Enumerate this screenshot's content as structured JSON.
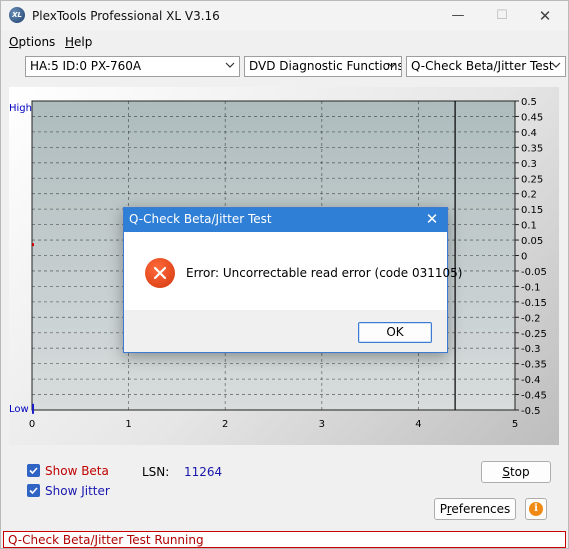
{
  "window": {
    "title": "PlexTools Professional XL V3.16",
    "icon_label": "XL"
  },
  "menu": {
    "options": "Options",
    "help": "Help"
  },
  "toolbar": {
    "drive": "HA:5 ID:0  PX-760A",
    "function": "DVD Diagnostic Functions",
    "test": "Q-Check Beta/Jitter Test"
  },
  "chart_data": {
    "type": "line",
    "x_ticks": [
      "0",
      "1",
      "2",
      "3",
      "4",
      "5"
    ],
    "xlim": [
      0,
      5
    ],
    "left_labels": {
      "top": "High",
      "bottom": "Low"
    },
    "y_right_ticks": [
      "0.5",
      "0.45",
      "0.4",
      "0.35",
      "0.3",
      "0.25",
      "0.2",
      "0.15",
      "0.1",
      "0.05",
      "0",
      "-0.05",
      "-0.1",
      "-0.15",
      "-0.2",
      "-0.25",
      "-0.3",
      "-0.35",
      "-0.4",
      "-0.45",
      "-0.5"
    ],
    "ylim": [
      -0.5,
      0.5
    ],
    "grid": true,
    "marker_x": 4.38,
    "colors": {
      "plot_bg": "#b7c4c6",
      "grid": "#1a1a1a",
      "marker": "#000000",
      "left_text": "#0000c0"
    }
  },
  "dialog": {
    "title": "Q-Check Beta/Jitter Test",
    "message": "Error: Uncorrectable read error (code 031105)",
    "ok": "OK"
  },
  "controls": {
    "show_beta": "Show Beta",
    "show_jitter": "Show Jitter",
    "show_beta_checked": true,
    "show_jitter_checked": true,
    "lsn_label": "LSN:",
    "lsn_value": "11264",
    "stop": "Stop",
    "preferences": "Preferences"
  },
  "status": {
    "text": "Q-Check Beta/Jitter Test Running"
  }
}
